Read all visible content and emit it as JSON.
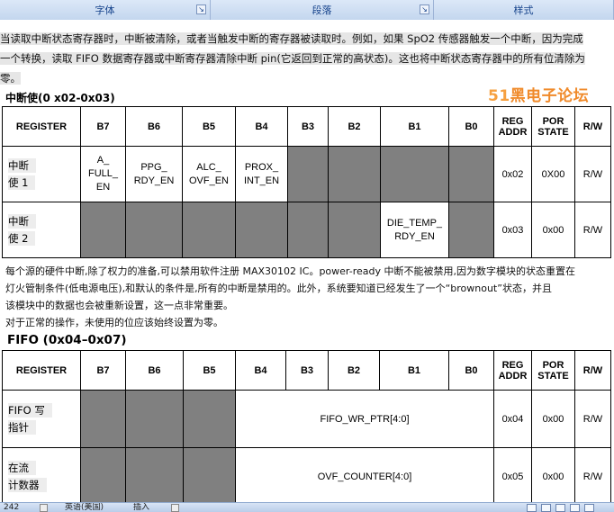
{
  "ribbon": {
    "groups": [
      "字体",
      "段落",
      "样式"
    ]
  },
  "doc": {
    "para1_lines": [
      "当读取中断状态寄存器时，中断被清除，或者当触发中断的寄存器被读取时。例如，如果 SpO2 传感器触发一个中断，因为完成",
      "一个转换，读取 FIFO 数据寄存器或中断寄存器清除中断 pin(它返回到正常的高状态)。这也将中断状态寄存器中的所有位清除为",
      "零。"
    ],
    "logo": {
      "num": "51",
      "text": "黑电子论坛"
    },
    "int_heading": "中断使(0 x02-0x03)",
    "int_table": {
      "headers": [
        "REGISTER",
        "B7",
        "B6",
        "B5",
        "B4",
        "B3",
        "B2",
        "B1",
        "B0",
        "REG ADDR",
        "POR STATE",
        "R/W"
      ],
      "rows": [
        {
          "name_lines": [
            "中断",
            "使 1"
          ],
          "b7": [
            "A_",
            "FULL_",
            "EN"
          ],
          "b6": [
            "PPG_",
            "RDY_EN"
          ],
          "b5": [
            "ALC_",
            "OVF_EN"
          ],
          "b4": [
            "PROX_",
            "INT_EN"
          ],
          "addr": "0x02",
          "por": "0X00",
          "rw": "R/W"
        },
        {
          "name_lines": [
            "中断",
            "使 2"
          ],
          "b1": [
            "DIE_TEMP_",
            "RDY_EN"
          ],
          "addr": "0x03",
          "por": "0x00",
          "rw": "R/W"
        }
      ]
    },
    "para2_lines": [
      "每个源的硬件中断,除了权力的准备,可以禁用软件注册 MAX30102 IC。power-ready 中断不能被禁用,因为数字模块的状态重置在",
      "灯火管制条件(低电源电压),和默认的条件是,所有的中断是禁用的。此外，系统要知道已经发生了一个“brownout”状态，并且",
      "该模块中的数据也会被重新设置，这一点非常重要。",
      "对于正常的操作，未使用的位应该始终设置为零。"
    ],
    "fifo_heading": "FIFO (0x04–0x07)",
    "fifo_table": {
      "headers": [
        "REGISTER",
        "B7",
        "B6",
        "B5",
        "B4",
        "B3",
        "B2",
        "B1",
        "B0",
        "REG ADDR",
        "POR STATE",
        "R/W"
      ],
      "rows": [
        {
          "name_lines": [
            "FIFO 写",
            "指针"
          ],
          "field": "FIFO_WR_PTR[4:0]",
          "addr": "0x04",
          "por": "0x00",
          "rw": "R/W"
        },
        {
          "name_lines": [
            "在流",
            "计数器"
          ],
          "field": "OVF_COUNTER[4:0]",
          "addr": "0x05",
          "por": "0x00",
          "rw": "R/W"
        }
      ]
    }
  },
  "status_bar": {
    "page_count": "242",
    "language": "英语(美国)",
    "mode": "插入"
  }
}
